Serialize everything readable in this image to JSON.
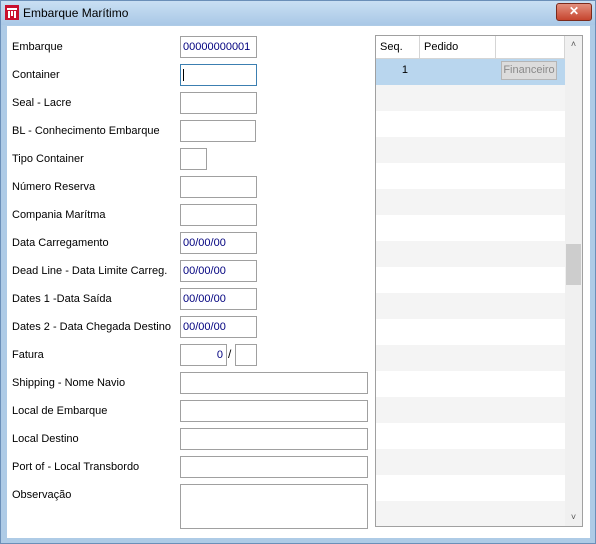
{
  "window": {
    "title": "Embarque Marítimo",
    "close_glyph": "✕",
    "app_icon": "app-logo-icon"
  },
  "form": {
    "embarque": {
      "label": "Embarque",
      "value": "00000000001"
    },
    "container": {
      "label": "Container",
      "value": ""
    },
    "seal": {
      "label": "Seal - Lacre",
      "value": ""
    },
    "bl": {
      "label": "BL - Conhecimento Embarque",
      "value": ""
    },
    "tipo_container": {
      "label": "Tipo Container",
      "value": ""
    },
    "numero_reserva": {
      "label": "Número Reserva",
      "value": ""
    },
    "companhia": {
      "label": "Compania Marítma",
      "value": ""
    },
    "data_carregamento": {
      "label": "Data Carregamento",
      "value": "00/00/00"
    },
    "dead_line": {
      "label": "Dead Line - Data Limite Carreg.",
      "value": "00/00/00"
    },
    "dates1": {
      "label": "Dates 1 -Data Saída",
      "value": "00/00/00"
    },
    "dates2": {
      "label": "Dates 2 - Data Chegada Destino",
      "value": "00/00/00"
    },
    "fatura": {
      "label": "Fatura",
      "value": "0",
      "separator": "/",
      "value2": ""
    },
    "shipping": {
      "label": "Shipping - Nome Navio",
      "value": ""
    },
    "local_embarque": {
      "label": "Local de Embarque",
      "value": ""
    },
    "local_destino": {
      "label": "Local Destino",
      "value": ""
    },
    "port_of": {
      "label": "Port of - Local Transbordo",
      "value": ""
    },
    "observacao": {
      "label": "Observação",
      "value": ""
    }
  },
  "grid": {
    "columns": [
      "Seq.",
      "Pedido"
    ],
    "rows": [
      {
        "seq": "1",
        "pedido": "",
        "button": "Financeiro"
      }
    ],
    "scroll_up_glyph": "˄",
    "scroll_down_glyph": "˅",
    "scroll_position": 0.46
  }
}
